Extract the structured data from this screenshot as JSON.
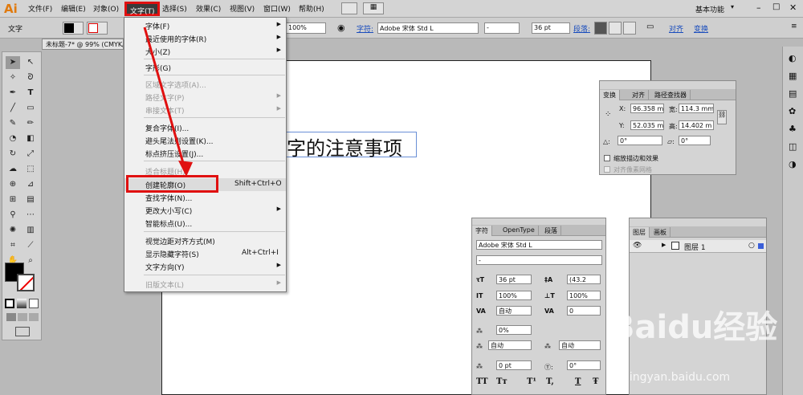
{
  "app": {
    "logo": "Ai",
    "workspace": "基本功能"
  },
  "menubar": {
    "items": [
      "文件(F)",
      "编辑(E)",
      "对象(O)",
      "文字(T)",
      "选择(S)",
      "效果(C)",
      "视图(V)",
      "窗口(W)",
      "帮助(H)"
    ]
  },
  "control": {
    "label": "文字",
    "zoom": "100%",
    "char_label": "字符:",
    "font": "Adobe 宋体 Std L",
    "style": "-",
    "size": "36 pt",
    "para_label": "段落:",
    "align_label": "对齐",
    "transform_label": "变换"
  },
  "doc_tab": "未标题-7* @ 99% (CMYK/预览)",
  "canvas": {
    "text": "字的注意事项"
  },
  "text_menu": {
    "items": [
      {
        "label": "字体(F)",
        "arrow": "▶",
        "disabled": false
      },
      {
        "label": "最近使用的字体(R)",
        "arrow": "▶",
        "disabled": false
      },
      {
        "label": "大小(Z)",
        "arrow": "▶",
        "disabled": false
      },
      {
        "label": "字形(G)",
        "disabled": false
      },
      {
        "label": "区域文字选项(A)...",
        "disabled": true
      },
      {
        "label": "路径文字(P)",
        "arrow": "▶",
        "disabled": true
      },
      {
        "label": "串接文本(T)",
        "arrow": "▶",
        "disabled": true
      },
      {
        "label": "复合字体(I)...",
        "disabled": false
      },
      {
        "label": "避头尾法则设置(K)...",
        "disabled": false
      },
      {
        "label": "标点挤压设置(J)...",
        "disabled": false
      },
      {
        "label": "适合标题(H)",
        "disabled": true
      },
      {
        "label": "创建轮廓(O)",
        "shortcut": "Shift+Ctrl+O",
        "disabled": false
      },
      {
        "label": "查找字体(N)...",
        "disabled": false
      },
      {
        "label": "更改大小写(C)",
        "arrow": "▶",
        "disabled": false
      },
      {
        "label": "智能标点(U)...",
        "disabled": false
      },
      {
        "label": "视觉边距对齐方式(M)",
        "disabled": false
      },
      {
        "label": "显示隐藏字符(S)",
        "shortcut": "Alt+Ctrl+I",
        "disabled": false
      },
      {
        "label": "文字方向(Y)",
        "arrow": "▶",
        "disabled": false
      },
      {
        "label": "旧版文本(L)",
        "arrow": "▶",
        "disabled": true
      }
    ]
  },
  "transform_panel": {
    "tabs": [
      "变换",
      "对齐",
      "路径查找器"
    ],
    "x_label": "X:",
    "x": "96.358 m",
    "w_label": "宽:",
    "w": "114.3 mm",
    "y_label": "Y:",
    "y": "52.035 m",
    "h_label": "高:",
    "h": "14.402 m",
    "rotate": "0°",
    "shear": "0°",
    "scale_strokes": "缩放描边和效果",
    "align_pixel": "对齐像素网格"
  },
  "char_panel": {
    "tabs": [
      "字符",
      "OpenType",
      "段落"
    ],
    "font": "Adobe 宋体 Std L",
    "style": "-",
    "size": "36 pt",
    "leading": "(43.2",
    "hscale": "100%",
    "vscale": "100%",
    "kerning": "自动",
    "tracking": "0",
    "tsume": "0%",
    "aki_left": "自动",
    "aki_right": "自动",
    "baseline": "0 pt",
    "rotation": "0°",
    "styles": [
      "TT",
      "Tт",
      "T¹",
      "T,",
      "T",
      "Ŧ"
    ]
  },
  "layers_panel": {
    "tabs": [
      "图层",
      "画板"
    ],
    "layer": "图层 1"
  },
  "watermark": {
    "text": "Baidu经验",
    "url": "jingyan.baidu.com"
  }
}
